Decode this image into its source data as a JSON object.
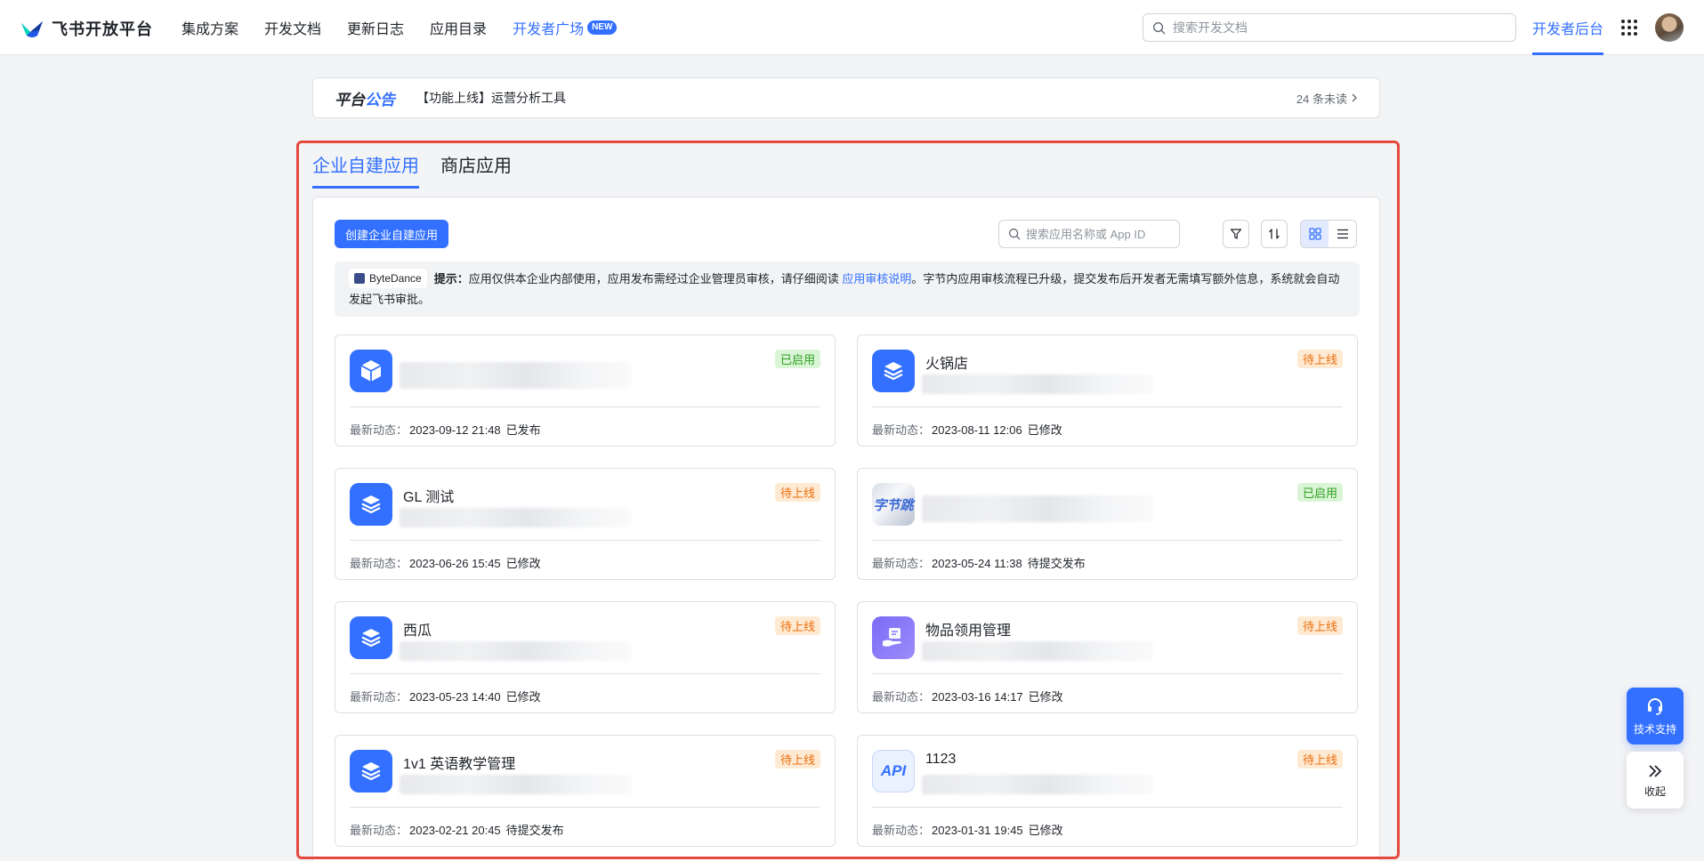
{
  "brand": {
    "name": "飞书开放平台"
  },
  "nav": {
    "items": [
      {
        "label": "集成方案"
      },
      {
        "label": "开发文档"
      },
      {
        "label": "更新日志"
      },
      {
        "label": "应用目录"
      }
    ],
    "dev_square": {
      "label": "开发者广场",
      "badge": "NEW"
    }
  },
  "top_search": {
    "placeholder": "搜索开发文档"
  },
  "dev_console": {
    "label": "开发者后台"
  },
  "announcement": {
    "title_prefix": "平台",
    "title_suffix": "公告",
    "text": "【功能上线】运营分析工具",
    "unread": "24 条未读"
  },
  "tabs": [
    {
      "label": "企业自建应用",
      "active": true
    },
    {
      "label": "商店应用",
      "active": false
    }
  ],
  "toolbar": {
    "create_label": "创建企业自建应用",
    "search_placeholder": "搜索应用名称或 App ID"
  },
  "tip": {
    "org": "ByteDance",
    "lead": "提示：",
    "text_before": "应用仅供本企业内部使用，应用发布需经过企业管理员审核，请仔细阅读",
    "link": "应用审核说明",
    "text_after": "。字节内应用审核流程已升级，提交发布后开发者无需填写额外信息，系统就会自动发起飞书审批。"
  },
  "meta_label": "最新动态：",
  "apps": [
    {
      "name": "",
      "icon": "cube-icon",
      "icon_text": "",
      "status": "已启用",
      "status_type": "on",
      "time": "2023-09-12 21:48",
      "action": "已发布"
    },
    {
      "name": "火锅店",
      "icon": "layers-icon",
      "icon_text": "",
      "status": "待上线",
      "status_type": "pending",
      "time": "2023-08-11 12:06",
      "action": "已修改"
    },
    {
      "name": "GL 测试",
      "icon": "layers-icon",
      "icon_text": "",
      "status": "待上线",
      "status_type": "pending",
      "time": "2023-06-26 15:45",
      "action": "已修改"
    },
    {
      "name": "",
      "icon": "bytedance-logo-icon",
      "icon_text": "字节跳",
      "status": "已启用",
      "status_type": "on",
      "time": "2023-05-24 11:38",
      "action": "待提交发布"
    },
    {
      "name": "西瓜",
      "icon": "layers-icon",
      "icon_text": "",
      "status": "待上线",
      "status_type": "pending",
      "time": "2023-05-23 14:40",
      "action": "已修改"
    },
    {
      "name": "物品领用管理",
      "icon": "hand-box-icon",
      "icon_text": "",
      "status": "待上线",
      "status_type": "pending",
      "time": "2023-03-16 14:17",
      "action": "已修改"
    },
    {
      "name": "1v1 英语教学管理",
      "icon": "layers-icon",
      "icon_text": "",
      "status": "待上线",
      "status_type": "pending",
      "time": "2023-02-21 20:45",
      "action": "待提交发布"
    },
    {
      "name": "1123",
      "icon": "api-icon",
      "icon_text": "API",
      "status": "待上线",
      "status_type": "pending",
      "time": "2023-01-31 19:45",
      "action": "已修改"
    }
  ],
  "floating": {
    "support": "技术支持",
    "collapse": "收起"
  }
}
